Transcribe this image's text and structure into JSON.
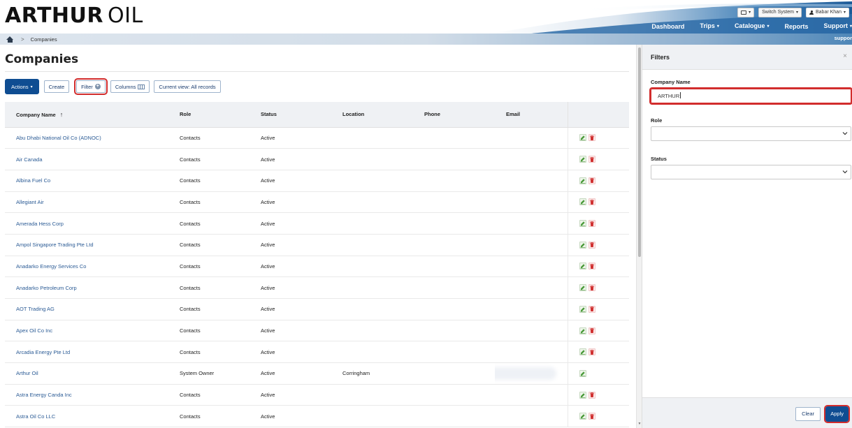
{
  "header": {
    "logo_bold": "ARTHUR",
    "logo_light": "OIL",
    "switch_system_label": "Switch System",
    "user_name": "Babar Khan",
    "nav": [
      {
        "label": "Dashboard",
        "has_caret": false
      },
      {
        "label": "Trips",
        "has_caret": true
      },
      {
        "label": "Catalogue",
        "has_caret": true
      },
      {
        "label": "Reports",
        "has_caret": false
      },
      {
        "label": "Support",
        "has_caret": true
      }
    ],
    "nav_caret_glyph": "▾"
  },
  "breadcrumb": {
    "separator": ">",
    "current": "Companies",
    "right_text": "suppor"
  },
  "page": {
    "title": "Companies"
  },
  "toolbar": {
    "actions_label": "Actions",
    "create_label": "Create",
    "filter_label": "Filter",
    "columns_label": "Columns",
    "view_label": "Current view: All records"
  },
  "table": {
    "columns": [
      "Company Name",
      "Role",
      "Status",
      "Location",
      "Phone",
      "Email"
    ],
    "sort_indicator": "↑",
    "rows": [
      {
        "name": "Abu Dhabi National Oil Co (ADNOC)",
        "role": "Contacts",
        "status": "Active",
        "location": "",
        "phone": "",
        "email": "",
        "deletable": true
      },
      {
        "name": "Air Canada",
        "role": "Contacts",
        "status": "Active",
        "location": "",
        "phone": "",
        "email": "",
        "deletable": true
      },
      {
        "name": "Albina Fuel Co",
        "role": "Contacts",
        "status": "Active",
        "location": "",
        "phone": "",
        "email": "",
        "deletable": true
      },
      {
        "name": "Allegiant Air",
        "role": "Contacts",
        "status": "Active",
        "location": "",
        "phone": "",
        "email": "",
        "deletable": true
      },
      {
        "name": "Amerada Hess Corp",
        "role": "Contacts",
        "status": "Active",
        "location": "",
        "phone": "",
        "email": "",
        "deletable": true
      },
      {
        "name": "Ampol Singapore Trading Pte Ltd",
        "role": "Contacts",
        "status": "Active",
        "location": "",
        "phone": "",
        "email": "",
        "deletable": true
      },
      {
        "name": "Anadarko Energy Services Co",
        "role": "Contacts",
        "status": "Active",
        "location": "",
        "phone": "",
        "email": "",
        "deletable": true
      },
      {
        "name": "Anadarko Petroleum Corp",
        "role": "Contacts",
        "status": "Active",
        "location": "",
        "phone": "",
        "email": "",
        "deletable": true
      },
      {
        "name": "AOT Trading AG",
        "role": "Contacts",
        "status": "Active",
        "location": "",
        "phone": "",
        "email": "",
        "deletable": true
      },
      {
        "name": "Apex Oil Co Inc",
        "role": "Contacts",
        "status": "Active",
        "location": "",
        "phone": "",
        "email": "",
        "deletable": true
      },
      {
        "name": "Arcadia Energy Pte Ltd",
        "role": "Contacts",
        "status": "Active",
        "location": "",
        "phone": "",
        "email": "",
        "deletable": true
      },
      {
        "name": "Arthur Oil",
        "role": "System Owner",
        "status": "Active",
        "location": "Corringham",
        "phone": "",
        "email": "",
        "deletable": false,
        "email_blurred": true
      },
      {
        "name": "Astra Energy Canda Inc",
        "role": "Contacts",
        "status": "Active",
        "location": "",
        "phone": "",
        "email": "",
        "deletable": true
      },
      {
        "name": "Astra Oil Co LLC",
        "role": "Contacts",
        "status": "Active",
        "location": "",
        "phone": "",
        "email": "",
        "deletable": true
      }
    ]
  },
  "filters": {
    "title": "Filters",
    "close_glyph": "×",
    "company_name_label": "Company Name",
    "company_name_value": "ARTHUR",
    "role_label": "Role",
    "role_value": "",
    "status_label": "Status",
    "status_value": "",
    "clear_label": "Clear",
    "apply_label": "Apply"
  },
  "colors": {
    "primary": "#0f4d92",
    "link": "#2b5b95",
    "highlight": "#d22d2d",
    "header_dark": "#1f5f9b"
  }
}
